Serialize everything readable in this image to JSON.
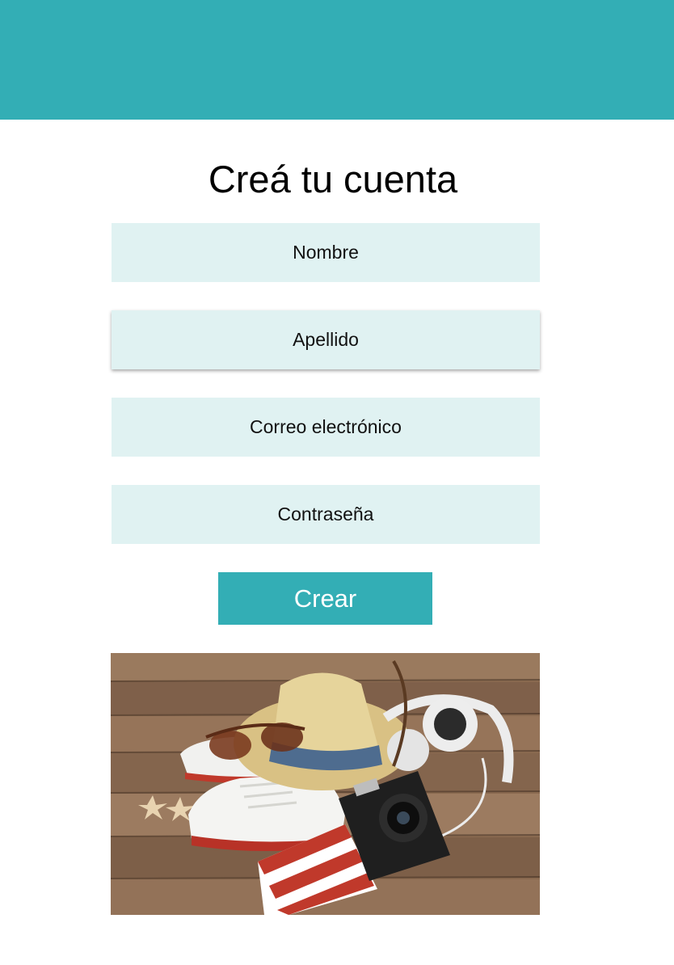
{
  "colors": {
    "header": "#33aeb5",
    "field_bg": "#e0f2f2",
    "button_bg": "#33aeb5"
  },
  "form": {
    "title": "Creá tu cuenta",
    "fields": [
      {
        "placeholder": "Nombre"
      },
      {
        "placeholder": "Apellido"
      },
      {
        "placeholder": "Correo electrónico"
      },
      {
        "placeholder": "Contraseña"
      }
    ],
    "submit_label": "Crear"
  },
  "photo": {
    "icon": "travel-items-photo"
  }
}
